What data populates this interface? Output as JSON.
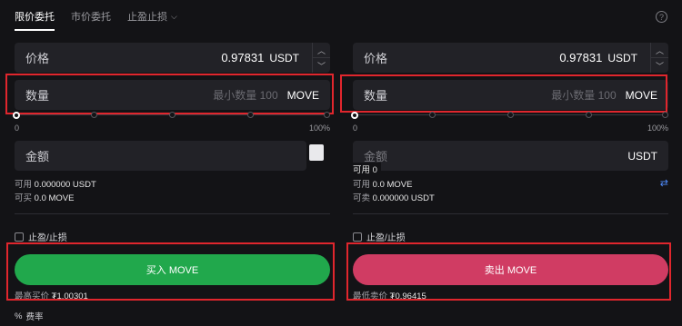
{
  "tabs": [
    {
      "label": "限价委托",
      "active": true
    },
    {
      "label": "市价委托",
      "active": false
    },
    {
      "label": "止盈止损",
      "active": false,
      "dropdown": true
    }
  ],
  "help_icon": "?",
  "buy": {
    "price_label": "价格",
    "price_value": "0.97831",
    "price_unit": "USDT",
    "qty_label": "数量",
    "qty_placeholder": "最小数量 100",
    "qty_unit": "MOVE",
    "slider_min": "0",
    "slider_max": "100%",
    "amount_label": "金额",
    "avail_label": "可用",
    "avail_value": "0.000000 USDT",
    "can_label": "可买",
    "can_value": "0.0 MOVE",
    "tpsl_label": "止盈/止损",
    "button_label": "买入 MOVE",
    "best_label": "最高买价",
    "best_value": "₮1.00301"
  },
  "sell": {
    "price_label": "价格",
    "price_value": "0.97831",
    "price_unit": "USDT",
    "qty_label": "数量",
    "qty_placeholder": "最小数量 100",
    "qty_unit": "MOVE",
    "slider_min": "0",
    "slider_max": "100%",
    "amount_label": "金额",
    "amount_unit": "USDT",
    "avail_label": "可用",
    "avail_value": "0.0 MOVE",
    "avail_overlay": "可用 0",
    "can_label": "可卖",
    "can_value": "0.000000 USDT",
    "tpsl_label": "止盈/止损",
    "button_label": "卖出 MOVE",
    "best_label": "最低卖价",
    "best_value": "₮0.96415"
  },
  "fee_label": "费率",
  "fee_icon": "%",
  "colors": {
    "buy": "#21a84c",
    "sell": "#d03c63",
    "highlight": "#e0262d"
  }
}
